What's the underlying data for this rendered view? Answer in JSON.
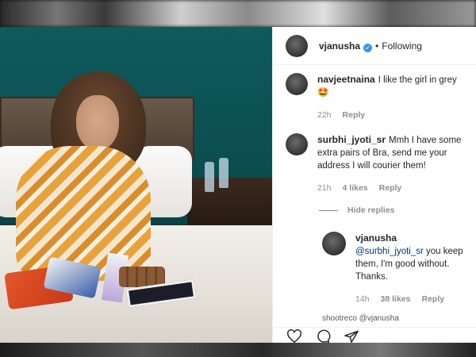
{
  "post": {
    "author": "vjanusha",
    "follow_label": "Following",
    "dot": "•"
  },
  "comments": [
    {
      "username": "navjeetnaina",
      "text": "I like the girl in grey",
      "emoji": "🤩",
      "time": "22h",
      "reply_label": "Reply"
    },
    {
      "username": "surbhi_jyoti_sr",
      "text": "Mmh I have some extra pairs of Bra, send me your address I will courier them!",
      "time": "21h",
      "likes": "4 likes",
      "reply_label": "Reply"
    }
  ],
  "hide_replies_label": "Hide replies",
  "reply": {
    "username": "vjanusha",
    "mention": "@surbhi_jyoti_sr",
    "text": "you keep them, I'm good without. Thanks.",
    "time": "14h",
    "likes": "38 likes",
    "reply_label": "Reply"
  },
  "peek_text": "shootreco    @vjanusha",
  "icons": [
    "heart-icon",
    "comment-icon",
    "share-icon"
  ],
  "colors": {
    "verified": "#3897f0",
    "meta": "#8e8e8e",
    "text": "#262626"
  }
}
